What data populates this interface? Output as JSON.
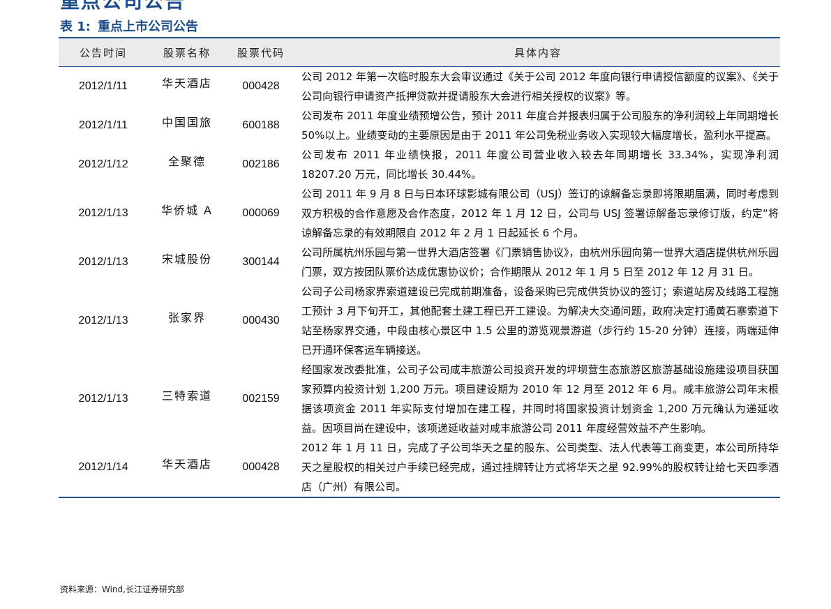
{
  "page": {
    "heading": "重点公司公告",
    "caption_label": "表 1:",
    "caption_title": "重点上市公司公告",
    "source_note": "资料来源：Wind,长江证券研究部"
  },
  "table": {
    "headers": [
      "公告时间",
      "股票名称",
      "股票代码",
      "具体内容"
    ],
    "rows": [
      {
        "date": "2012/1/11",
        "name": "华天酒店",
        "code": "000428",
        "content": "公司 2012 年第一次临时股东大会审议通过《关于公司 2012 年度向银行申请授信额度的议案》、《关于公司向银行申请资产抵押贷款并提请股东大会进行相关授权的议案》等。"
      },
      {
        "date": "2012/1/11",
        "name": "中国国旅",
        "code": "600188",
        "content": "公司发布 2011 年度业绩预增公告，预计 2011 年度合并报表归属于公司股东的净利润较上年同期增长 50%以上。业绩变动的主要原因是由于 2011 年公司免税业务收入实现较大幅度增长，盈利水平提高。"
      },
      {
        "date": "2012/1/12",
        "name": "全聚德",
        "code": "002186",
        "content": "公司发布 2011 年业绩快报，2011 年度公司营业收入较去年同期增长 33.34%，实现净利润 18207.20 万元，同比增长 30.44%。"
      },
      {
        "date": "2012/1/13",
        "name": "华侨城 A",
        "code": "000069",
        "content": "公司 2011 年 9 月 8 日与日本环球影城有限公司（USJ）签订的谅解备忘录即将限期届满，同时考虑到双方积极的合作意愿及合作态度，2012 年 1 月 12 日，公司与 USJ 签署谅解备忘录修订版，约定“将谅解备忘录的有效期限自 2012 年 2 月 1 日起延长 6 个月。"
      },
      {
        "date": "2012/1/13",
        "name": "宋城股份",
        "code": "300144",
        "content": "公司所属杭州乐园与第一世界大酒店签署《门票销售协议》，由杭州乐园向第一世界大酒店提供杭州乐园门票，双方按团队票价达成优惠协议价；合作期限从 2012 年 1 月 5 日至 2012 年 12 月 31 日。"
      },
      {
        "date": "2012/1/13",
        "name": "张家界",
        "code": "000430",
        "content": "公司子公司杨家界索道建设已完成前期准备，设备采购已完成供货协议的签订；索道站房及线路工程施工预计 3 月下旬开工，其他配套土建工程已开工建设。为解决大交通问题，政府决定打通黄石寨索道下站至杨家界交通，中段由核心景区中 1.5 公里的游览观景游道（步行约 15-20 分钟）连接，两端延伸已开通环保客运车辆接送。"
      },
      {
        "date": "2012/1/13",
        "name": "三特索道",
        "code": "002159",
        "content": "经国家发改委批准，公司子公司咸丰旅游公司投资开发的坪坝营生态旅游区旅游基础设施建设项目获国家预算内投资计划 1,200 万元。项目建设期为 2010 年 12 月至 2012 年 6 月。咸丰旅游公司年末根据该项资金 2011 年实际支付增加在建工程，并同时将国家投资计划资金 1,200 万元确认为递延收益。因项目尚在建设中，该项递延收益对咸丰旅游公司 2011 年度经营效益不产生影响。"
      },
      {
        "date": "2012/1/14",
        "name": "华天酒店",
        "code": "000428",
        "content": "2012 年 1 月 11 日，完成了子公司华天之星的股东、公司类型、法人代表等工商变更，本公司所持华天之星股权的相关过户手续已经完成，通过挂牌转让方式将华天之星 92.99%的股权转让给七天四季酒店（广州）有限公司。"
      }
    ]
  },
  "colors": {
    "accent": "#1f4e8c",
    "header_bg": "#ebebeb"
  }
}
